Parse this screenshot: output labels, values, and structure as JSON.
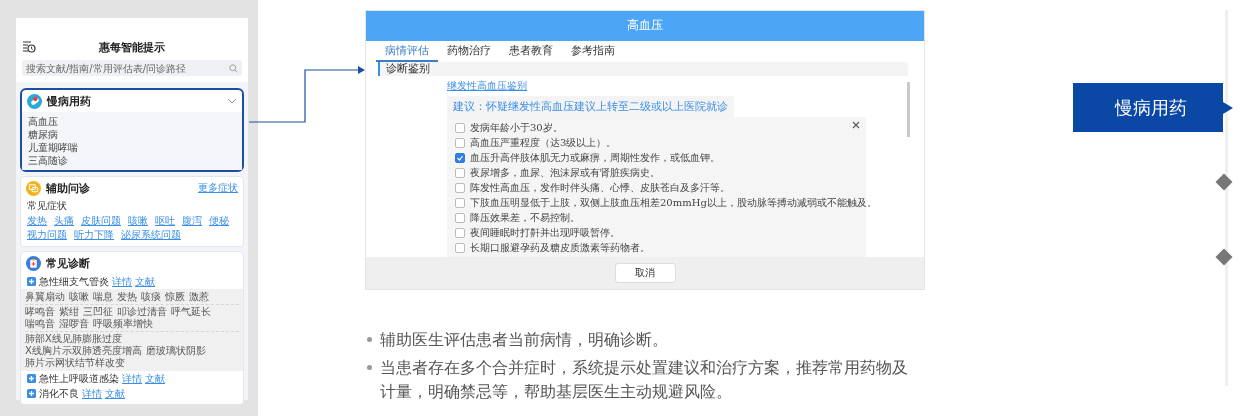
{
  "phone": {
    "title": "惠每智能提示",
    "search": {
      "placeholder": "搜索文献/指南/常用评估表/问诊路径"
    },
    "chronic_card": {
      "title": "慢病用药",
      "selected": true,
      "items": [
        "高血压",
        "糖尿病",
        "儿童期哮喘",
        "三高随诊"
      ]
    },
    "inquiry_card": {
      "title": "辅助问诊",
      "more_link": "更多症状",
      "subtitle": "常见症状",
      "symptoms": [
        "发热",
        "头痛",
        "皮肤问题",
        "咳嗽",
        "呕吐",
        "腹泻",
        "便秘",
        "视力问题",
        "听力下降",
        "泌尿系统问题"
      ]
    },
    "diagnosis_card": {
      "title": "常见诊断",
      "items": [
        {
          "name": "急性细支气管炎",
          "links": [
            "详情",
            "文献"
          ],
          "finding_groups": [
            [
              "鼻翼扇动",
              "咳嗽",
              "喘息",
              "发热",
              "咳痰",
              "惊厥",
              "激惹"
            ],
            [
              "哮鸣音",
              "紫绀",
              "三凹征",
              "叩诊过清音",
              "呼气延长",
              "喘鸣音",
              "湿啰音",
              "呼吸频率增快"
            ],
            [
              "肺部X线见肺膨胀过度",
              "X线胸片示双肺透亮度增高",
              "磨玻璃状阴影",
              "肺片示网状结节样改变"
            ]
          ]
        },
        {
          "name": "急性上呼吸道感染",
          "links": [
            "详情",
            "文献"
          ]
        },
        {
          "name": "消化不良",
          "links": [
            "详情",
            "文献"
          ]
        }
      ]
    }
  },
  "modal": {
    "title": "高血压",
    "tabs": [
      {
        "label": "病情评估",
        "selected": true
      },
      {
        "label": "药物治疗",
        "selected": false
      },
      {
        "label": "患者教育",
        "selected": false
      },
      {
        "label": "参考指南",
        "selected": false
      }
    ],
    "section": "诊断鉴别",
    "link": "继发性高血压鉴别",
    "suggestion": "建议：怀疑继发性高血压建议上转至二级或以上医院就诊",
    "checklist": [
      {
        "text": "发病年龄小于30岁。",
        "checked": false
      },
      {
        "text": "高血压严重程度（达3级以上）。",
        "checked": false
      },
      {
        "text": "血压升高伴肢体肌无力或麻痹，周期性发作，或低血钾。",
        "checked": true
      },
      {
        "text": "夜尿增多，血尿、泡沫尿或有肾脏疾病史。",
        "checked": false
      },
      {
        "text": "阵发性高血压，发作时伴头痛、心悸、皮肤苍白及多汗等。",
        "checked": false
      },
      {
        "text": "下肢血压明显低于上肢，双侧上肢血压相差20mmHg以上，股动脉等搏动减弱或不能触及。",
        "checked": false
      },
      {
        "text": "降压效果差，不易控制。",
        "checked": false
      },
      {
        "text": "夜间睡眠时打鼾并出现呼吸暂停。",
        "checked": false
      },
      {
        "text": "长期口服避孕药及糖皮质激素等药物者。",
        "checked": false
      }
    ],
    "cancel_button": "取消"
  },
  "bullets": [
    "辅助医生评估患者当前病情，明确诊断。",
    "当患者存在多个合并症时，系统提示处置建议和治疗方案，推荐常用药物及计量，明确禁忌等，帮助基层医生主动规避风险。"
  ],
  "timeline": [
    {
      "kind": "tab",
      "label": "慢病用药",
      "selected": true
    },
    {
      "kind": "marker",
      "selected": false
    },
    {
      "kind": "marker",
      "selected": false
    }
  ]
}
